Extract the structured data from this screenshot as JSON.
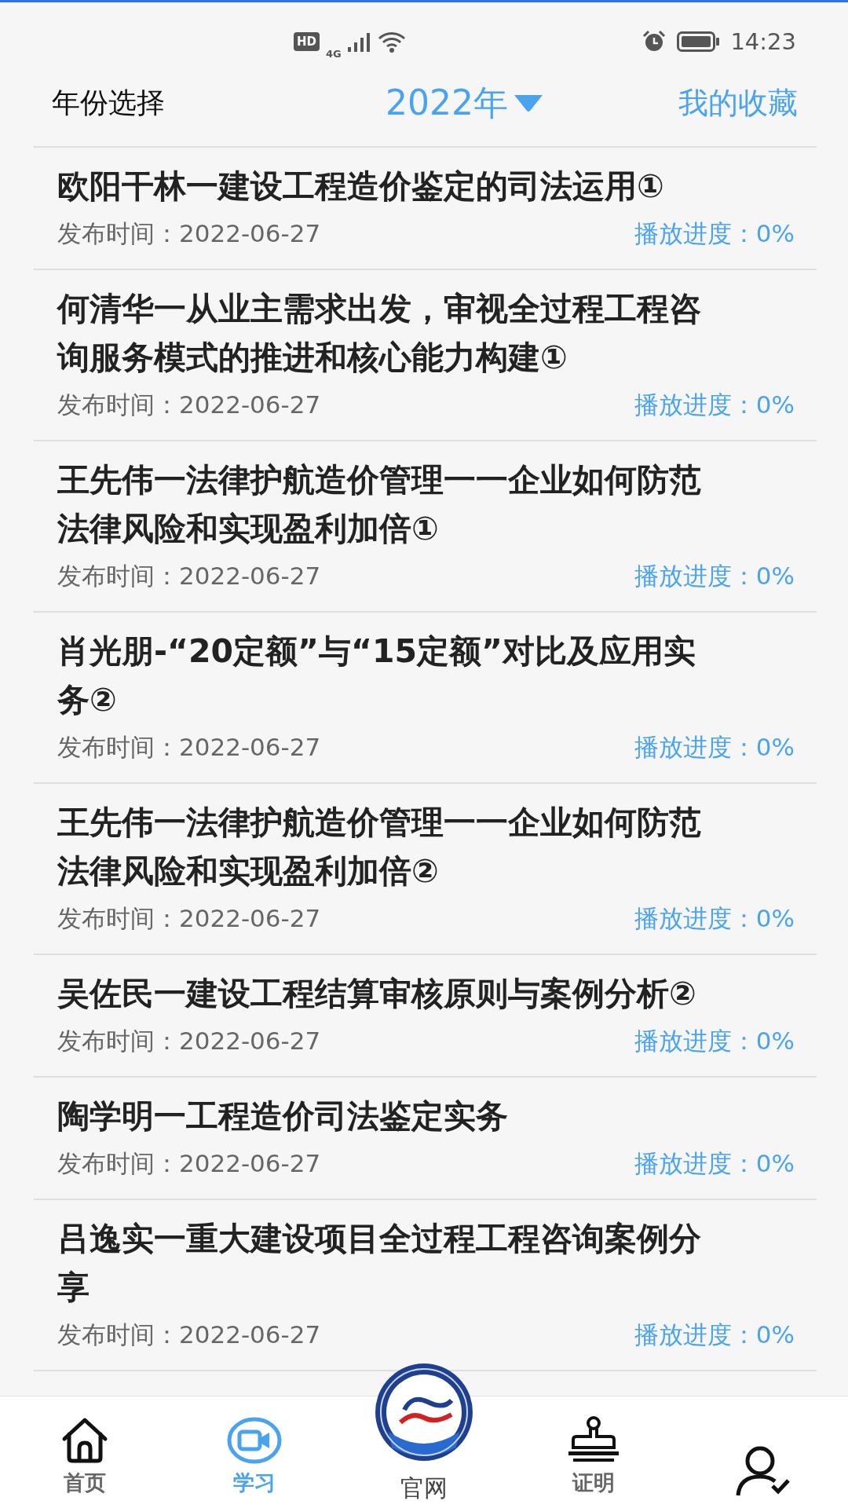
{
  "status_bar": {
    "hd": "HD",
    "time": "14:23",
    "network": "4G"
  },
  "header": {
    "title": "年份选择",
    "year": "2022年",
    "favorites": "我的收藏"
  },
  "items": [
    {
      "title": "欧阳干林一建设工程造价鉴定的司法运用①",
      "date": "发布时间：2022-06-27",
      "progress": "播放进度：0%"
    },
    {
      "title": "何清华一从业主需求出发，审视全过程工程咨询服务模式的推进和核心能力构建①",
      "date": "发布时间：2022-06-27",
      "progress": "播放进度：0%"
    },
    {
      "title": "王先伟一法律护航造价管理一一企业如何防范法律风险和实现盈利加倍①",
      "date": "发布时间：2022-06-27",
      "progress": "播放进度：0%"
    },
    {
      "title": "肖光朋-“20定额”与“15定额”对比及应用实务②",
      "date": "发布时间：2022-06-27",
      "progress": "播放进度：0%"
    },
    {
      "title": "王先伟一法律护航造价管理一一企业如何防范法律风险和实现盈利加倍②",
      "date": "发布时间：2022-06-27",
      "progress": "播放进度：0%"
    },
    {
      "title": "吴佐民一建设工程结算审核原则与案例分析②",
      "date": "发布时间：2022-06-27",
      "progress": "播放进度：0%"
    },
    {
      "title": "陶学明一工程造价司法鉴定实务",
      "date": "发布时间：2022-06-27",
      "progress": "播放进度：0%"
    },
    {
      "title": "吕逸实一重大建设项目全过程工程咨询案例分享",
      "date": "发布时间：2022-06-27",
      "progress": "播放进度：0%"
    }
  ],
  "nav": [
    {
      "kind": "home",
      "label": "首页",
      "selected": false
    },
    {
      "kind": "study",
      "label": "学习",
      "selected": true
    },
    {
      "kind": "emblem",
      "label": "官网",
      "selected": false
    },
    {
      "kind": "stamp",
      "label": "证明",
      "selected": false
    },
    {
      "kind": "user",
      "selected": false
    }
  ]
}
